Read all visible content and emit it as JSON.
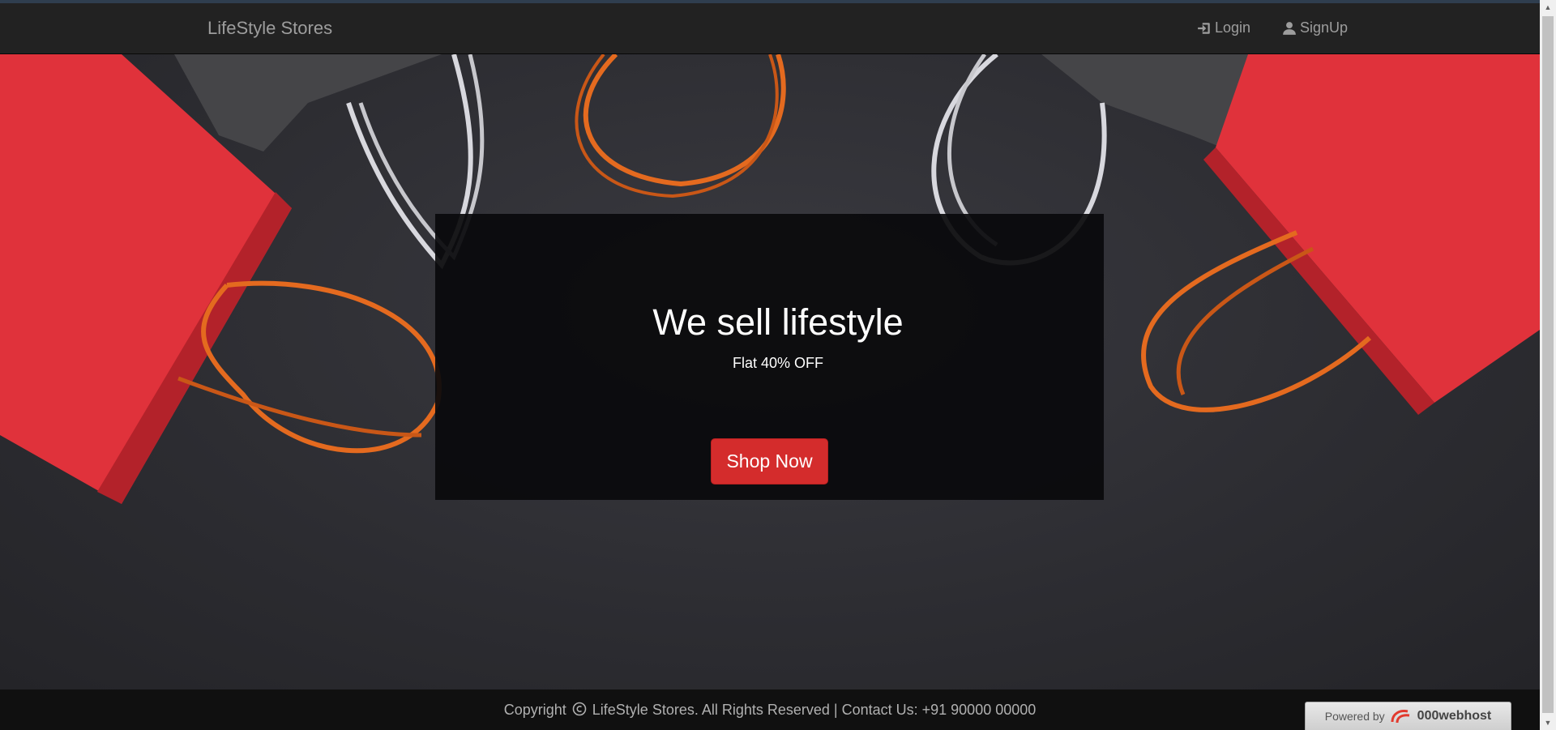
{
  "navbar": {
    "brand": "LifeStyle Stores",
    "login_label": "Login",
    "signup_label": "SignUp",
    "login_icon": "log-in-icon",
    "signup_icon": "user-icon"
  },
  "hero": {
    "title": "We sell lifestyle",
    "subtitle": "Flat 40% OFF",
    "cta_label": "Shop Now"
  },
  "footer": {
    "copyright_prefix": "Copyright",
    "copyright_text": "LifeStyle Stores. All Rights Reserved | Contact Us: +91 90000 00000"
  },
  "powered_badge": {
    "prefix": "Powered by",
    "host": "000webhost"
  },
  "colors": {
    "navbar_bg": "#222222",
    "accent": "#d42c2c",
    "footer_bg": "#101010"
  }
}
